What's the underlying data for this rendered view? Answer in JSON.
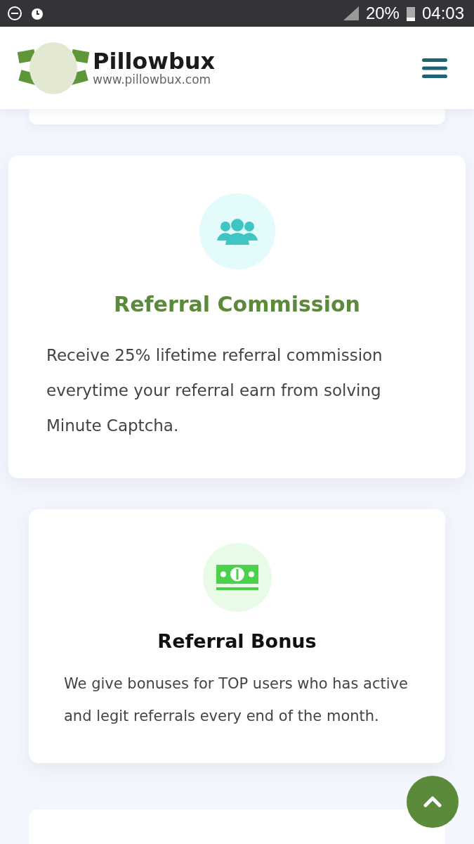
{
  "status_bar": {
    "battery": "20%",
    "time": "04:03"
  },
  "header": {
    "brand": "Pillowbux",
    "url": "www.pillowbux.com"
  },
  "features": [
    {
      "kind": "referral",
      "title": "Referral Commission",
      "text": "Receive 25% lifetime referral commission everytime your referral earn from solving Minute Captcha.",
      "highlighted": true
    },
    {
      "kind": "money",
      "title": "Referral Bonus",
      "text": "We give bonuses for TOP users who has active and legit referrals every end of the month.",
      "highlighted": false
    }
  ]
}
